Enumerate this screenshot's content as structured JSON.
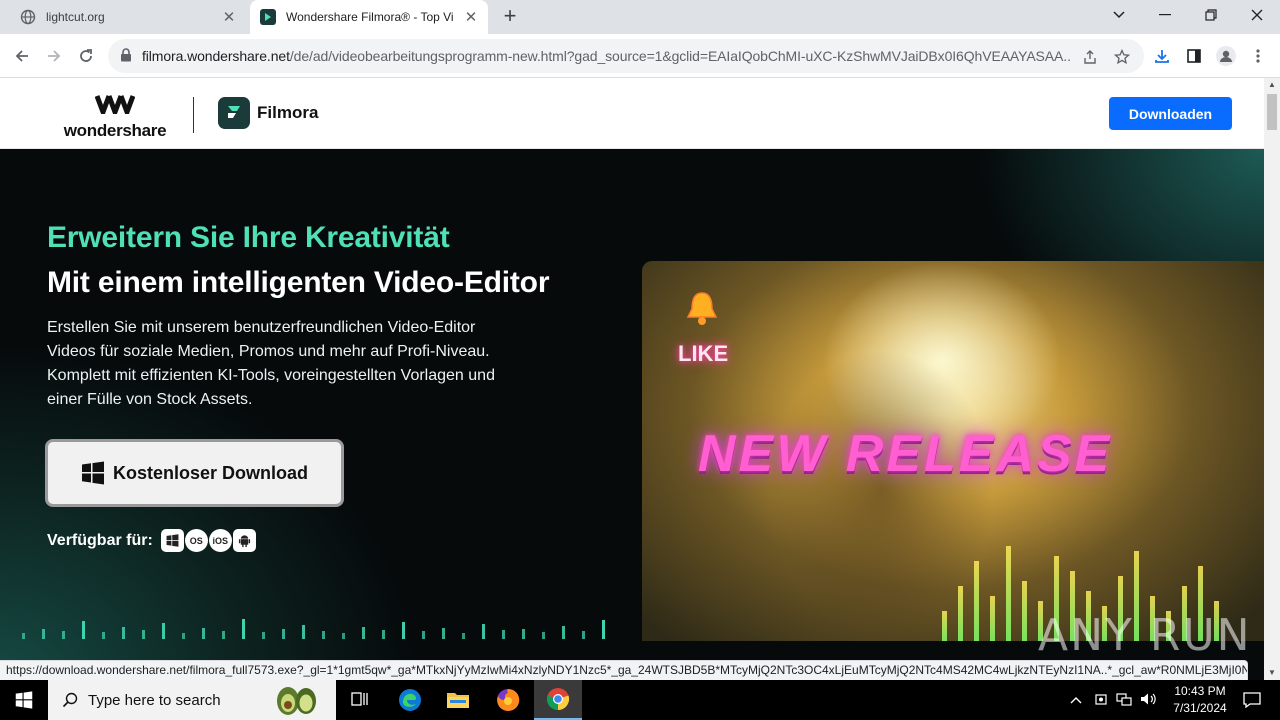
{
  "browser": {
    "tabs": [
      {
        "title": "lightcut.org",
        "active": false
      },
      {
        "title": "Wondershare Filmora® - Top Vi",
        "active": true
      }
    ],
    "url_domain": "filmora.wondershare.net",
    "url_rest": "/de/ad/videobearbeitungsprogramm-new.html?gad_source=1&gclid=EAIaIQobChMI-uXC-KzShwMVJaiDBx0I6QhVEAAYASAA...",
    "status_url": "https://download.wondershare.net/filmora_full7573.exe?_gl=1*1gmt5qw*_ga*MTkxNjYyMzIwMi4xNzlyNDY1Nzc5*_ga_24WTSJBD5B*MTcyMjQ2NTc3OC4xLjEuMTcyMjQ2NTc4MS42MC4wLjkzNTEyNzI1NA..*_gcl_aw*R0NMLjE3MjI0NjU3..."
  },
  "site": {
    "brand_word": "wondershare",
    "product_name": "Filmora",
    "header_download": "Downloaden",
    "hero": {
      "headline_green": "Erweitern Sie Ihre Kreativität",
      "headline_white": "Mit einem intelligenten Video-Editor",
      "desc_lines": [
        "Erstellen Sie mit unserem benutzerfreundlichen Video-Editor",
        "Videos für soziale Medien, Promos und mehr auf Profi-Niveau.",
        "Komplett mit effizienten KI-Tools, voreingestellten Vorlagen und",
        "einer Fülle von Stock Assets."
      ],
      "cta": "Kostenloser Download",
      "available_label": "Verfügbar für:",
      "platforms": [
        "windows",
        "macOS",
        "iOS",
        "android"
      ],
      "platform_labels": {
        "mac": "OS",
        "ios": "iOS"
      },
      "video_text": "NEW RELEASE",
      "video_like": "LIKE"
    },
    "colors": {
      "accent_green": "#4fe0b5",
      "button_blue": "#0a6cff"
    }
  },
  "watermark": "ANY RUN",
  "taskbar": {
    "search_placeholder": "Type here to search",
    "time": "10:43 PM",
    "date": "7/31/2024"
  }
}
